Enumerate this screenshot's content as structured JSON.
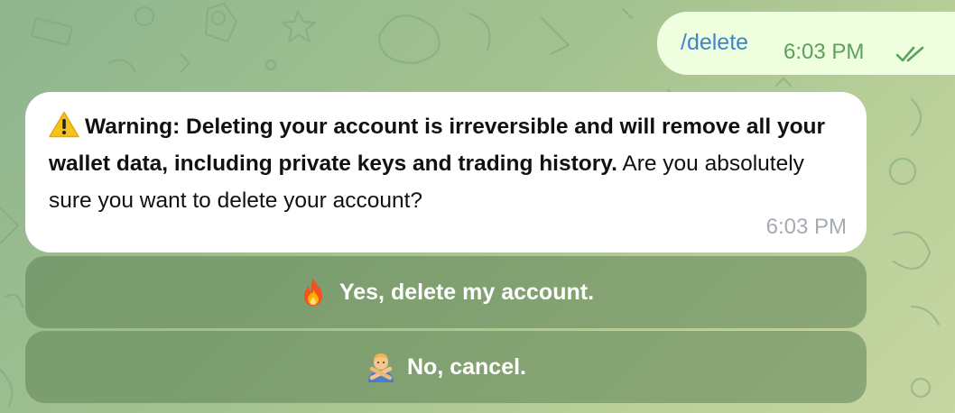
{
  "outgoing_message": {
    "text": "/delete",
    "time": "6:03 PM",
    "status_icon": "double-check-icon"
  },
  "incoming_message": {
    "warning_icon": "warning-icon",
    "bold_text": "Warning: Deleting your account is irreversible and will remove all your wallet data, including private keys and trading history.",
    "normal_text": "Are you absolutely sure you want to delete your account?",
    "time": "6:03 PM"
  },
  "inline_keyboard": [
    {
      "label": "Yes, delete my account.",
      "icon": "fire-icon"
    },
    {
      "label": "No, cancel.",
      "icon": "person-gesturing-no-icon"
    }
  ],
  "colors": {
    "outgoing_bubble": "#eefedf",
    "incoming_bubble": "#ffffff",
    "link_command": "#3d86c8",
    "outgoing_time": "#5aa15b",
    "incoming_time": "#a5abb2",
    "keyboard_button": "#6f8f63"
  }
}
